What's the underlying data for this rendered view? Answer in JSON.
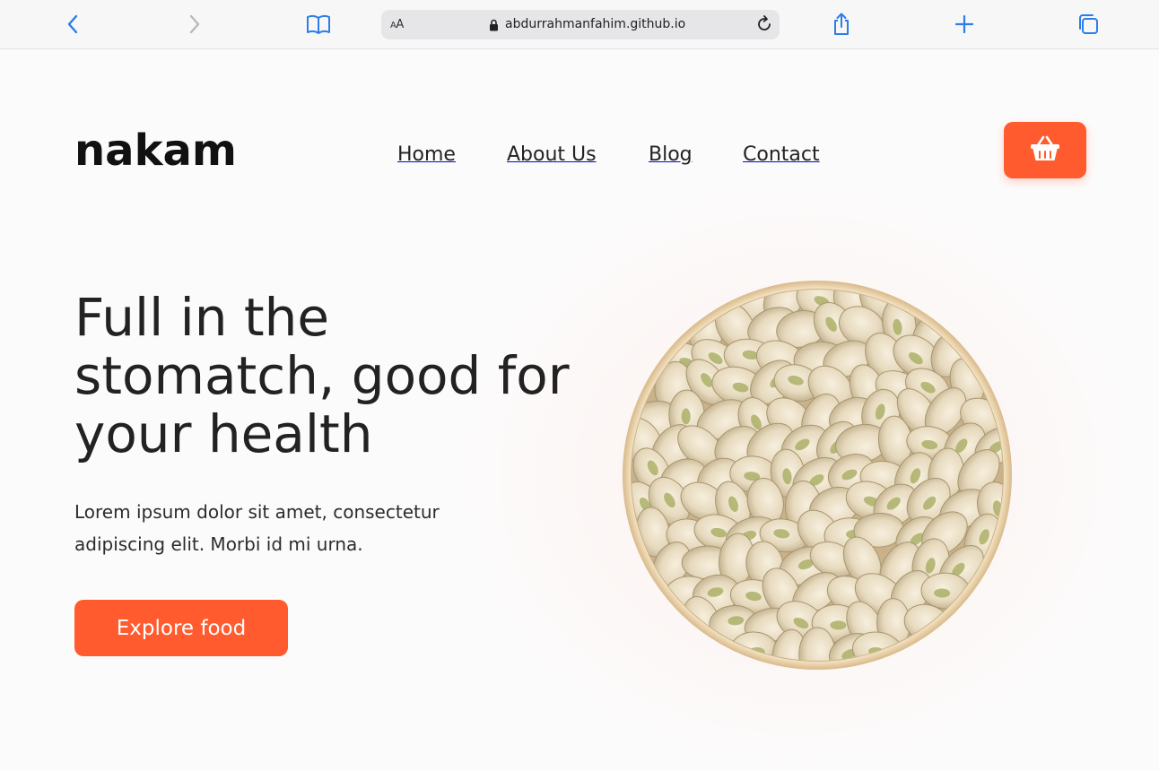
{
  "browser": {
    "text_size_label": "AA",
    "url": "abdurrahmanfahim.github.io",
    "icons": [
      "back-icon",
      "forward-icon",
      "book-icon",
      "lock-icon",
      "reload-icon",
      "share-icon",
      "plus-icon",
      "tabs-icon"
    ]
  },
  "site": {
    "logo": "nakam",
    "nav": [
      "Home",
      "About Us",
      "Blog",
      "Contact"
    ],
    "cart_icon": "basket-icon"
  },
  "hero": {
    "headline_lines": [
      "Full in the",
      "stomatch, good for",
      "your health"
    ],
    "description_lines": [
      "Lorem ipsum dolor sit amet, consectetur",
      "adipiscing elit. Morbi id mi urna."
    ],
    "cta_label": "Explore food",
    "image": "bowl of pistachios"
  },
  "colors": {
    "accent": "#ff5b2e",
    "link_blue": "#2b7de9",
    "text": "#1f1f1f"
  }
}
